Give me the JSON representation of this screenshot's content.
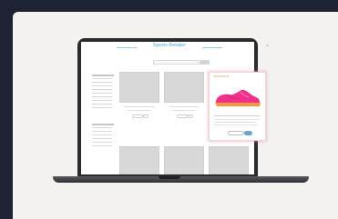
{
  "app": {
    "title": "Sports Retailer",
    "close_symbol": "×"
  },
  "search": {
    "placeholder": ""
  },
  "popup": {
    "title": "Sportswear",
    "product_image": "pink-running-shoe"
  },
  "colors": {
    "background": "#1f2233",
    "card": "#f3f2ef",
    "accent": "#4ea7dc",
    "shoe": "#f0308a",
    "sole": "#f49a3a"
  }
}
